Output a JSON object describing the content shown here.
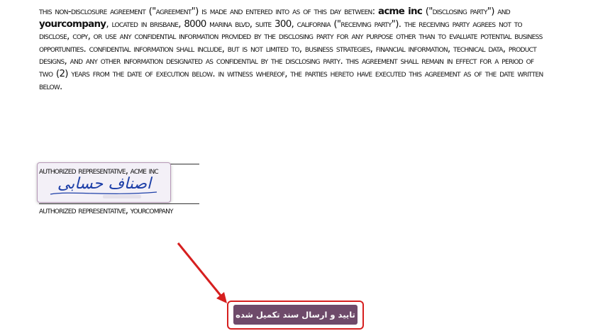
{
  "document": {
    "p_intro": "This non-disclosure agreement (\"Agreement\") is made and entered into as of this day between",
    "party_a": "acme inc",
    "p_party_a_role": "(\"Disclosing Party\") and",
    "party_b": "YourCompany",
    "p_rest": ", located in Brisbane, 8000 Marina Blvd, Suite 300, California (\"Receiving Party\"). The Receiving Party agrees not to disclose, copy, or use any confidential information provided by the Disclosing Party for any purpose other than to evaluate potential business opportunities. Confidential information shall include, but is not limited to, business strategies, financial information, technical data, product designs, and any other information designated as confidential by the Disclosing Party. This agreement shall remain in effect for a period of two (2) years from the date of execution below. In witness whereof, the parties hereto have executed this agreement as of the date written below."
  },
  "signatures": {
    "caption_a": "Authorized Representative, acme inc",
    "caption_b": "Authorized Representative, YourCompany",
    "signature_text": "اصناف حسابی"
  },
  "actions": {
    "confirm_button_label": "تایید و ارسال سند تکمیل شده"
  },
  "colors": {
    "button_bg": "#6e4a6a",
    "highlight": "#d61f1f",
    "signature_ink": "#1d3fa8"
  }
}
